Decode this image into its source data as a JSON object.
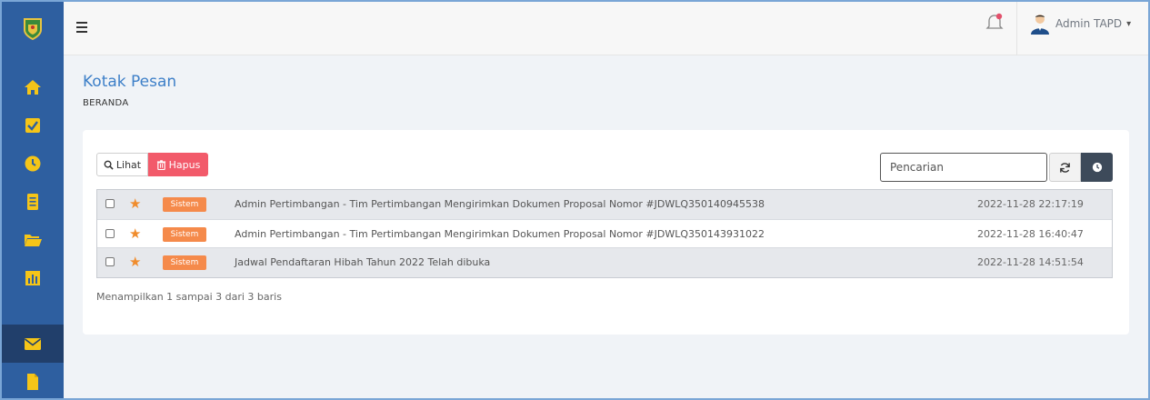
{
  "header": {
    "logo_icon": "regional-emblem-icon",
    "menu_icon": "hamburger-icon",
    "notification_icon": "bell-icon",
    "user": {
      "name": "Admin TAPD",
      "avatar_icon": "user-avatar-icon",
      "caret_icon": "chevron-down-icon"
    }
  },
  "sidebar": {
    "items": [
      {
        "icon": "home-icon"
      },
      {
        "icon": "checkbox-icon"
      },
      {
        "icon": "clock-icon"
      },
      {
        "icon": "document-list-icon"
      },
      {
        "icon": "folder-open-icon"
      },
      {
        "icon": "bar-chart-icon"
      },
      {
        "icon": "envelope-icon",
        "active": true
      },
      {
        "icon": "file-icon"
      }
    ]
  },
  "page": {
    "title": "Kotak Pesan",
    "breadcrumb": "BERANDA"
  },
  "toolbar": {
    "view_label": "Lihat",
    "delete_label": "Hapus",
    "search_placeholder": "Pencarian",
    "refresh_icon": "refresh-icon",
    "clock_icon": "clock-icon"
  },
  "messages": [
    {
      "badge": "Sistem",
      "subject": "Admin Pertimbangan - Tim Pertimbangan Mengirimkan Dokumen Proposal Nomor #JDWLQ350140945538",
      "date": "2022-11-28 22:17:19"
    },
    {
      "badge": "Sistem",
      "subject": "Admin Pertimbangan - Tim Pertimbangan Mengirimkan Dokumen Proposal Nomor #JDWLQ350143931022",
      "date": "2022-11-28 16:40:47"
    },
    {
      "badge": "Sistem",
      "subject": "Jadwal Pendaftaran Hibah Tahun 2022 Telah dibuka",
      "date": "2022-11-28 14:51:54"
    }
  ],
  "pagination": {
    "summary": "Menampilkan 1 sampai 3 dari 3 baris"
  },
  "colors": {
    "sidebar": "#2e5fa0",
    "sidebar_active": "#213f6b",
    "accent": "#3d7fc8",
    "delete_button": "#f25a6a",
    "badge": "#f58a4b",
    "star": "#f08c2c"
  }
}
